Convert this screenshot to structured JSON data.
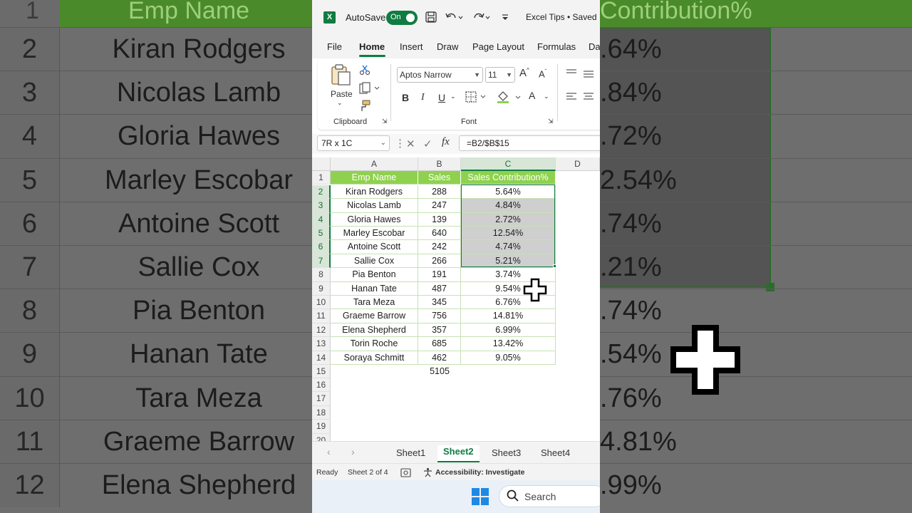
{
  "app": {
    "autosave_label": "AutoSave",
    "autosave_state": "On",
    "doc_title": "Excel Tips • Saved",
    "accent": "#107c41",
    "header_fill": "#8fd14f"
  },
  "menu": {
    "items": [
      "File",
      "Home",
      "Insert",
      "Draw",
      "Page Layout",
      "Formulas",
      "Da"
    ],
    "active": "Home"
  },
  "ribbon": {
    "paste_label": "Paste",
    "clipboard_label": "Clipboard",
    "font_label": "Font",
    "font_name": "Aptos Narrow",
    "font_size": "11",
    "bold": "B",
    "italic": "I",
    "underline": "U",
    "grow_font": "A",
    "shrink_font": "A",
    "font_color": "A"
  },
  "formula_bar": {
    "name_box": "7R x 1C",
    "fx_label": "fx",
    "formula": "=B2/$B$15"
  },
  "sheet": {
    "columns": [
      "A",
      "B",
      "C",
      "D"
    ],
    "header": [
      "Emp Name",
      "Sales",
      "Sales Contribution%"
    ],
    "rows": [
      {
        "n": "2",
        "name": "Kiran Rodgers",
        "sales": "288",
        "pct": "5.64%"
      },
      {
        "n": "3",
        "name": "Nicolas Lamb",
        "sales": "247",
        "pct": "4.84%"
      },
      {
        "n": "4",
        "name": "Gloria Hawes",
        "sales": "139",
        "pct": "2.72%"
      },
      {
        "n": "5",
        "name": "Marley Escobar",
        "sales": "640",
        "pct": "12.54%"
      },
      {
        "n": "6",
        "name": "Antoine Scott",
        "sales": "242",
        "pct": "4.74%"
      },
      {
        "n": "7",
        "name": "Sallie Cox",
        "sales": "266",
        "pct": "5.21%"
      },
      {
        "n": "8",
        "name": "Pia Benton",
        "sales": "191",
        "pct": "3.74%"
      },
      {
        "n": "9",
        "name": "Hanan Tate",
        "sales": "487",
        "pct": "9.54%"
      },
      {
        "n": "10",
        "name": "Tara Meza",
        "sales": "345",
        "pct": "6.76%"
      },
      {
        "n": "11",
        "name": "Graeme Barrow",
        "sales": "756",
        "pct": "14.81%"
      },
      {
        "n": "12",
        "name": "Elena Shepherd",
        "sales": "357",
        "pct": "6.99%"
      },
      {
        "n": "13",
        "name": "Torin Roche",
        "sales": "685",
        "pct": "13.42%"
      },
      {
        "n": "14",
        "name": "Soraya Schmitt",
        "sales": "462",
        "pct": "9.05%"
      }
    ],
    "total_row": "15",
    "total": "5105",
    "empty_rows": [
      "16",
      "17",
      "18",
      "19",
      "20"
    ],
    "header_row": "1"
  },
  "tabs": {
    "items": [
      "Sheet1",
      "Sheet2",
      "Sheet3",
      "Sheet4"
    ],
    "active": "Sheet2"
  },
  "status": {
    "ready": "Ready",
    "sheet_of": "Sheet 2 of 4",
    "accessibility": "Accessibility: Investigate"
  },
  "taskbar": {
    "search_label": "Search"
  },
  "background": {
    "header_name": "Emp Name",
    "header_pct": "Contribution%",
    "rows": [
      {
        "n": "1",
        "name": "",
        "pct": ""
      },
      {
        "n": "2",
        "name": "Kiran Rodgers",
        "pct": ".64%"
      },
      {
        "n": "3",
        "name": "Nicolas Lamb",
        "pct": ".84%"
      },
      {
        "n": "4",
        "name": "Gloria Hawes",
        "pct": ".72%"
      },
      {
        "n": "5",
        "name": "Marley Escobar",
        "pct": "2.54%"
      },
      {
        "n": "6",
        "name": "Antoine Scott",
        "pct": ".74%"
      },
      {
        "n": "7",
        "name": "Sallie Cox",
        "pct": ".21%"
      },
      {
        "n": "8",
        "name": "Pia Benton",
        "pct": ".74%"
      },
      {
        "n": "9",
        "name": "Hanan Tate",
        "pct": ".54%"
      },
      {
        "n": "10",
        "name": "Tara Meza",
        "pct": ".76%"
      },
      {
        "n": "11",
        "name": "Graeme Barrow",
        "pct": "4.81%"
      },
      {
        "n": "12",
        "name": "Elena Shepherd",
        "pct": ".99%"
      }
    ]
  }
}
